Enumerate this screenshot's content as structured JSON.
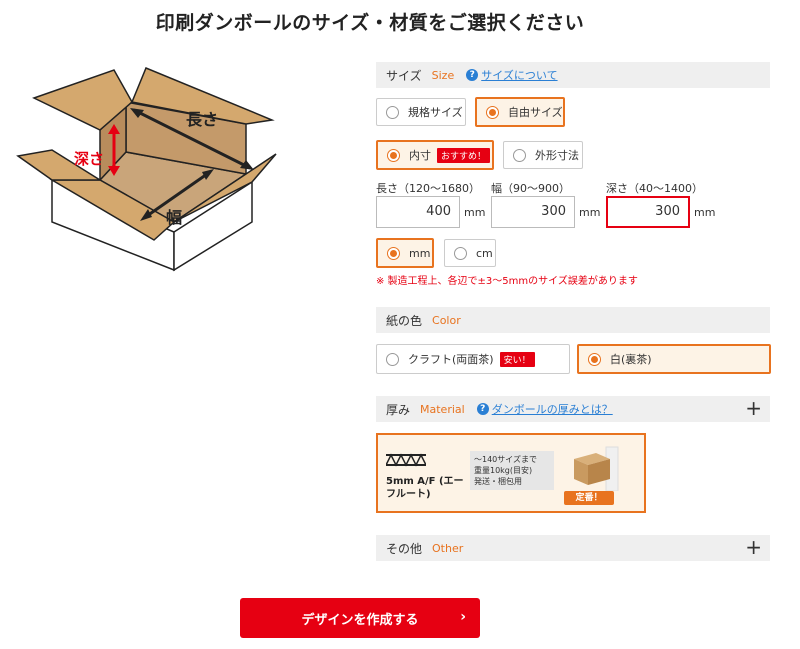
{
  "title": "印刷ダンボールのサイズ・材質をご選択ください",
  "illustration": {
    "length_label": "長さ",
    "depth_label": "深さ",
    "width_label": "幅"
  },
  "size": {
    "label_jp": "サイズ",
    "label_en": "Size",
    "help": "サイズについて",
    "options": [
      "規格サイズ",
      "自由サイズ"
    ],
    "selected": "自由サイズ",
    "measure_options": [
      "内寸",
      "外形寸法"
    ],
    "measure_badge": "おすすめ！",
    "measure_selected": "内寸",
    "fields": [
      {
        "label": "長さ（120〜1680）",
        "value": "400",
        "unit": "mm"
      },
      {
        "label": "幅（90〜900）",
        "value": "300",
        "unit": "mm"
      },
      {
        "label": "深さ（40〜1400）",
        "value": "300",
        "unit": "mm"
      }
    ],
    "unit_options": [
      "mm",
      "cm"
    ],
    "unit_selected": "mm",
    "note": "※ 製造工程上、各辺で±3〜5mmのサイズ誤差があります"
  },
  "paper_color": {
    "label_jp": "紙の色",
    "label_en": "Color",
    "options": [
      "クラフト(両面茶)",
      "白(裏茶)"
    ],
    "kraft_badge": "安い！",
    "selected": "白(裏茶)"
  },
  "thickness": {
    "label_jp": "厚み",
    "label_en": "Material",
    "help": "ダンボールの厚みとは？",
    "material_name": "5mm A/F (エーフルート)",
    "info": [
      "〜140サイズまで",
      "重量10kg(目安)",
      "発送・梱包用"
    ],
    "tag": "定番！"
  },
  "other": {
    "label_jp": "その他",
    "label_en": "Other"
  },
  "cta": "デザインを作成する",
  "colors": {
    "accent": "#e8731f",
    "red": "#e60012",
    "link": "#2a7fd4"
  }
}
